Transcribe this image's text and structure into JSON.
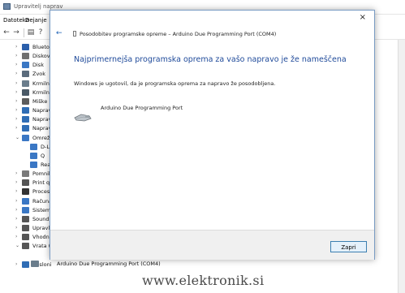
{
  "background_window": {
    "title": "Upravitelj naprav",
    "menu": [
      "Datoteka",
      "Dejanje"
    ],
    "tree_items": [
      {
        "label": "Bluetooth",
        "chev": "›",
        "color": "#2b5fab"
      },
      {
        "label": "Diskovni pogoni",
        "chev": "›",
        "color": "#707070"
      },
      {
        "label": "Disk",
        "chev": "›",
        "color": "#3a77c4"
      },
      {
        "label": "Zvok",
        "chev": "›",
        "color": "#5a6b7c"
      },
      {
        "label": "Krmilniki",
        "chev": "›",
        "color": "#6a7d8c"
      },
      {
        "label": "Krmilniki",
        "chev": "›",
        "color": "#4a5966"
      },
      {
        "label": "Miške",
        "chev": "›",
        "color": "#5c5c5c"
      },
      {
        "label": "Naprave",
        "chev": "›",
        "color": "#2f6db5"
      },
      {
        "label": "Naprave",
        "chev": "›",
        "color": "#2f6db5"
      },
      {
        "label": "Naprave",
        "chev": "›",
        "color": "#2f6db5"
      },
      {
        "label": "Omrežni vmesniki",
        "chev": "⌄",
        "color": "#3a77c4"
      },
      {
        "label": "D-L",
        "chev": "",
        "color": "#3a77c4"
      },
      {
        "label": "Q",
        "chev": "",
        "color": "#3a77c4"
      },
      {
        "label": "Rea",
        "chev": "",
        "color": "#3a77c4"
      },
      {
        "label": "Pomnilniške",
        "chev": "›",
        "color": "#7a7a7a"
      },
      {
        "label": "Print queues",
        "chev": "›",
        "color": "#555"
      },
      {
        "label": "Procesorji",
        "chev": "›",
        "color": "#333"
      },
      {
        "label": "Računalnik",
        "chev": "›",
        "color": "#3a77c4"
      },
      {
        "label": "Sistemske naprave",
        "chev": "›",
        "color": "#3a77c4"
      },
      {
        "label": "Sound",
        "chev": "›",
        "color": "#555"
      },
      {
        "label": "Upravljavec",
        "chev": "›",
        "color": "#555"
      },
      {
        "label": "Vhodne naprave",
        "chev": "›",
        "color": "#555"
      },
      {
        "label": "Vrata (COM in LPT)",
        "chev": "⌄",
        "color": "#555"
      },
      {
        "label": "",
        "chev": "",
        "color": "#ffffff"
      },
      {
        "label": "Zasloni",
        "chev": "›",
        "color": "#2f6db5"
      }
    ],
    "com_child_label": "Arduino Due Programming Port (COM4)"
  },
  "dialog": {
    "close_glyph": "×",
    "back_glyph": "←",
    "breadcrumb": "Posodobitev programske opreme – Arduino Due Programming Port (COM4)",
    "heading": "Najprimernejša programska oprema za vašo napravo je že nameščena",
    "body_text": "Windows je ugotovil, da je programska oprema za napravo že posodobljena.",
    "device_name": "Arduino Due Programming Port",
    "close_button_label": "Zapri"
  },
  "watermark": "www.elektronik.si",
  "icons": [
    "back-arrow-icon",
    "forward-arrow-icon",
    "device-icon",
    "usb-cable-icon",
    "close-icon"
  ],
  "colors": {
    "heading": "#1f4a9a",
    "back_arrow": "#1a5fb4",
    "button_border": "#3c7fb1",
    "dialog_border": "#7a9cc4"
  }
}
